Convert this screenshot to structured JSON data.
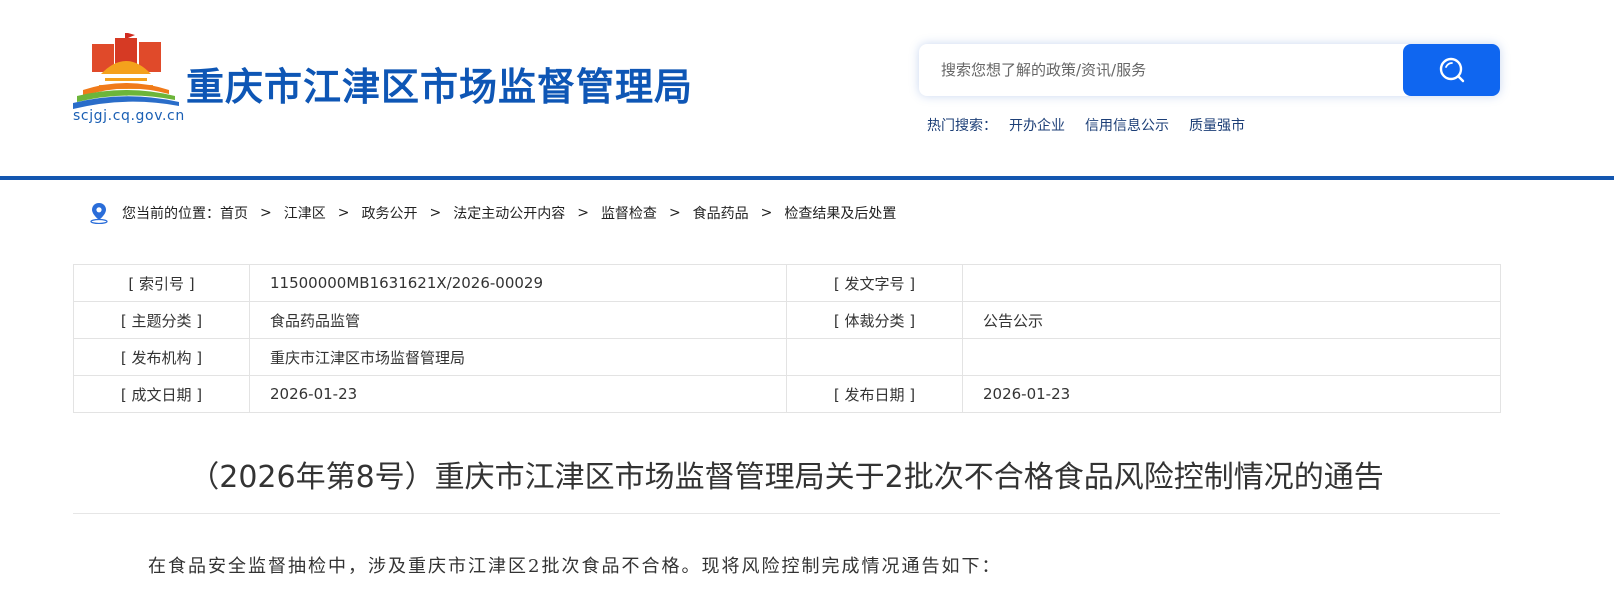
{
  "header": {
    "site_title": "重庆市江津区市场监督管理局",
    "domain": "scjgj.cq.gov.cn",
    "search_placeholder": "搜索您想了解的政策/资讯/服务",
    "hot_search_label": "热门搜索：",
    "hot_links": [
      "开办企业",
      "信用信息公示",
      "质量强市"
    ]
  },
  "breadcrumb": {
    "prefix": "您当前的位置：",
    "items": [
      "首页",
      "江津区",
      "政务公开",
      "法定主动公开内容",
      "监督检查",
      "食品药品",
      "检查结果及后处置"
    ],
    "separator": ">"
  },
  "info": {
    "rows": [
      {
        "label1": "[ 索引号 ]",
        "value1": "11500000MB1631621X/2026-00029",
        "label2": "[ 发文字号 ]",
        "value2": ""
      },
      {
        "label1": "[ 主题分类 ]",
        "value1": "食品药品监管",
        "label2": "[ 体裁分类 ]",
        "value2": "公告公示"
      },
      {
        "label1": "[ 发布机构 ]",
        "value1": "重庆市江津区市场监督管理局",
        "label2": "",
        "value2": ""
      },
      {
        "label1": "[ 成文日期 ]",
        "value1": "2026-01-23",
        "label2": "[ 发布日期 ]",
        "value2": "2026-01-23"
      }
    ]
  },
  "article": {
    "title": "（2026年第8号）重庆市江津区市场监督管理局关于2批次不合格食品风险控制情况的通告",
    "intro": "在食品安全监督抽检中，涉及重庆市江津区2批次食品不合格。现将风险控制完成情况通告如下："
  },
  "colors": {
    "brand_blue": "#0e56b5",
    "search_button": "#0f66f0",
    "divider": "#1356b0"
  },
  "icons": {
    "logo": "gov-emblem-logo",
    "search": "search-icon",
    "location": "location-pin-icon"
  }
}
